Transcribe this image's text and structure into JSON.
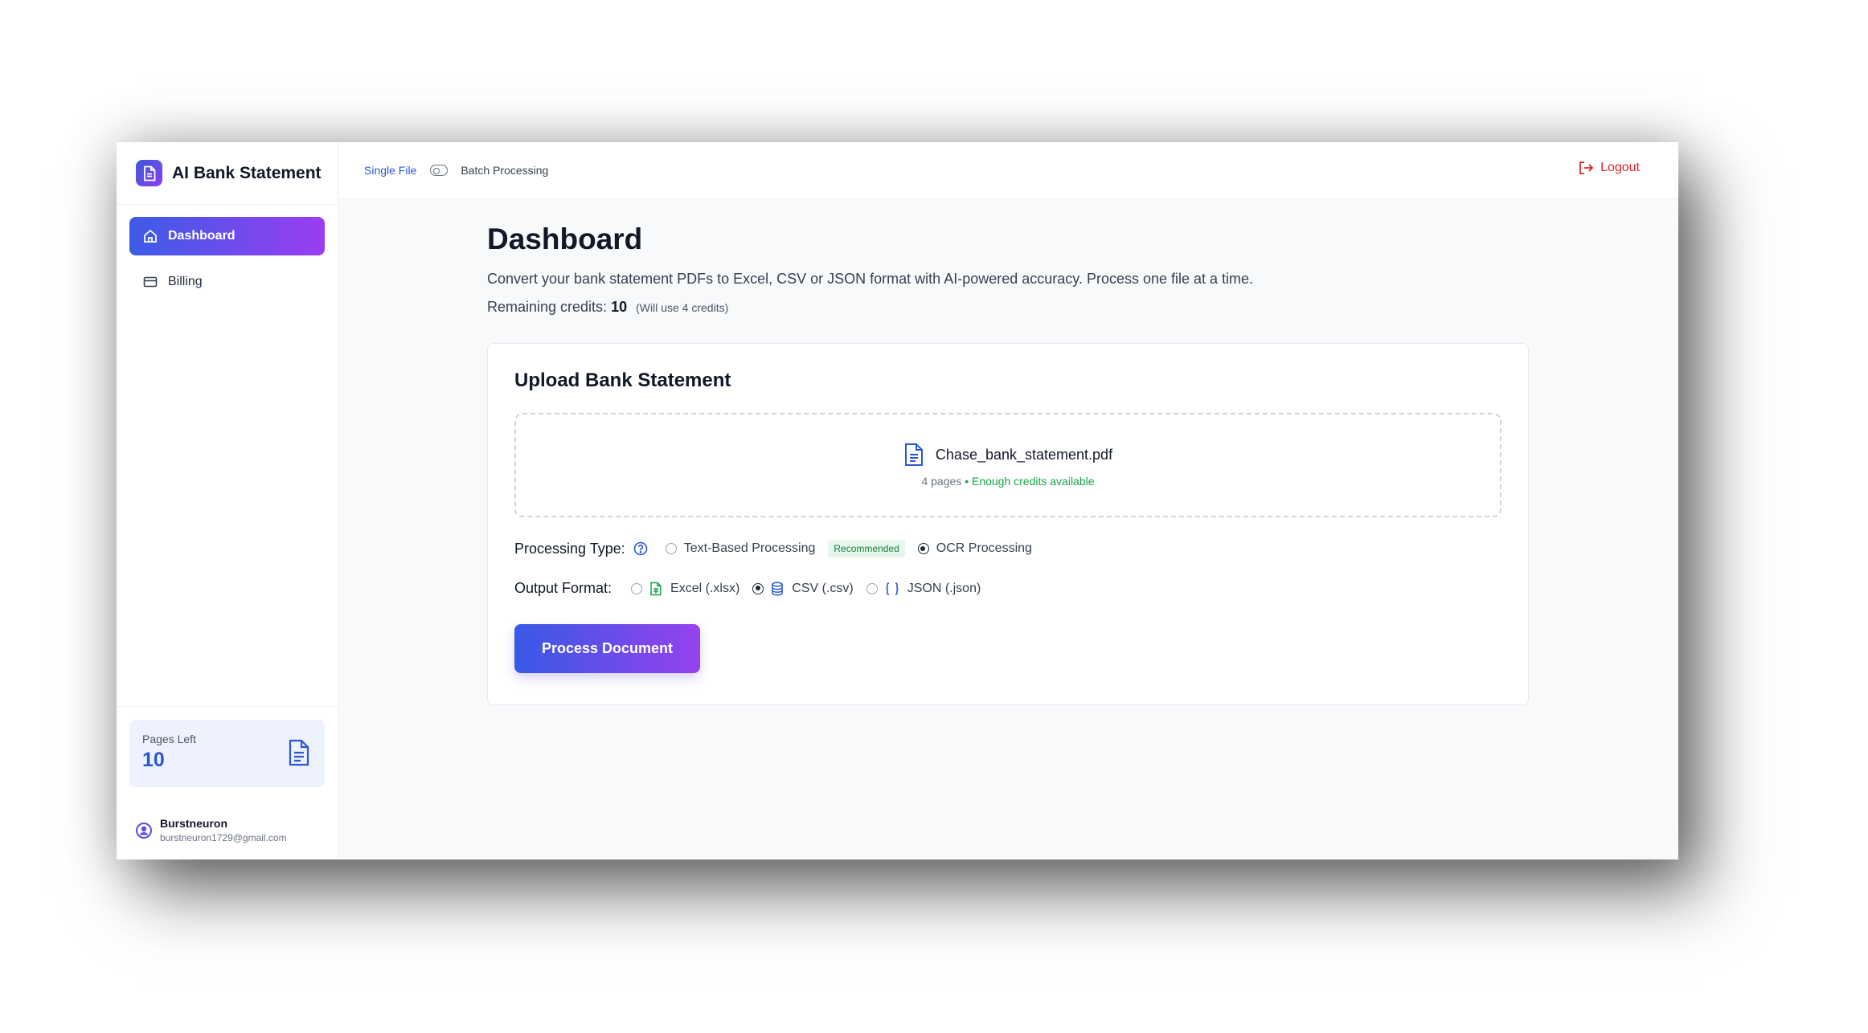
{
  "app": {
    "title": "AI Bank Statement"
  },
  "sidebar": {
    "items": [
      {
        "label": "Dashboard",
        "icon": "home-icon",
        "active": true
      },
      {
        "label": "Billing",
        "icon": "credit-card-icon",
        "active": false
      }
    ],
    "pages_card": {
      "label": "Pages Left",
      "value": "10"
    },
    "user": {
      "name": "Burstneuron",
      "email": "burstneuron1729@gmail.com"
    }
  },
  "topbar": {
    "single_label": "Single File",
    "batch_label": "Batch Processing",
    "logout_label": "Logout"
  },
  "main": {
    "title": "Dashboard",
    "description": "Convert your bank statement PDFs to Excel, CSV or JSON format with AI-powered accuracy. Process one file at a time.",
    "credits_label": "Remaining credits:",
    "credits_value": "10",
    "credits_note": "(Will use 4 credits)",
    "upload": {
      "title": "Upload Bank Statement",
      "file_name": "Chase_bank_statement.pdf",
      "pages": "4 pages",
      "separator": "•",
      "status": "Enough credits available"
    },
    "processing": {
      "label": "Processing Type:",
      "options": [
        {
          "label": "Text-Based Processing",
          "selected": false
        },
        {
          "label": "OCR Processing",
          "selected": true
        }
      ],
      "badge": "Recommended"
    },
    "output": {
      "label": "Output Format:",
      "options": [
        {
          "label": "Excel (.xlsx)",
          "icon": "spreadsheet-icon",
          "selected": false
        },
        {
          "label": "CSV (.csv)",
          "icon": "database-icon",
          "selected": true
        },
        {
          "label": "JSON (.json)",
          "icon": "braces-icon",
          "selected": false
        }
      ]
    },
    "process_button": "Process Document"
  },
  "colors": {
    "accent_start": "#3859e6",
    "accent_end": "#9641ee",
    "primary_blue": "#2b56d6",
    "success_green": "#16a34a",
    "danger_red": "#dc2626"
  }
}
